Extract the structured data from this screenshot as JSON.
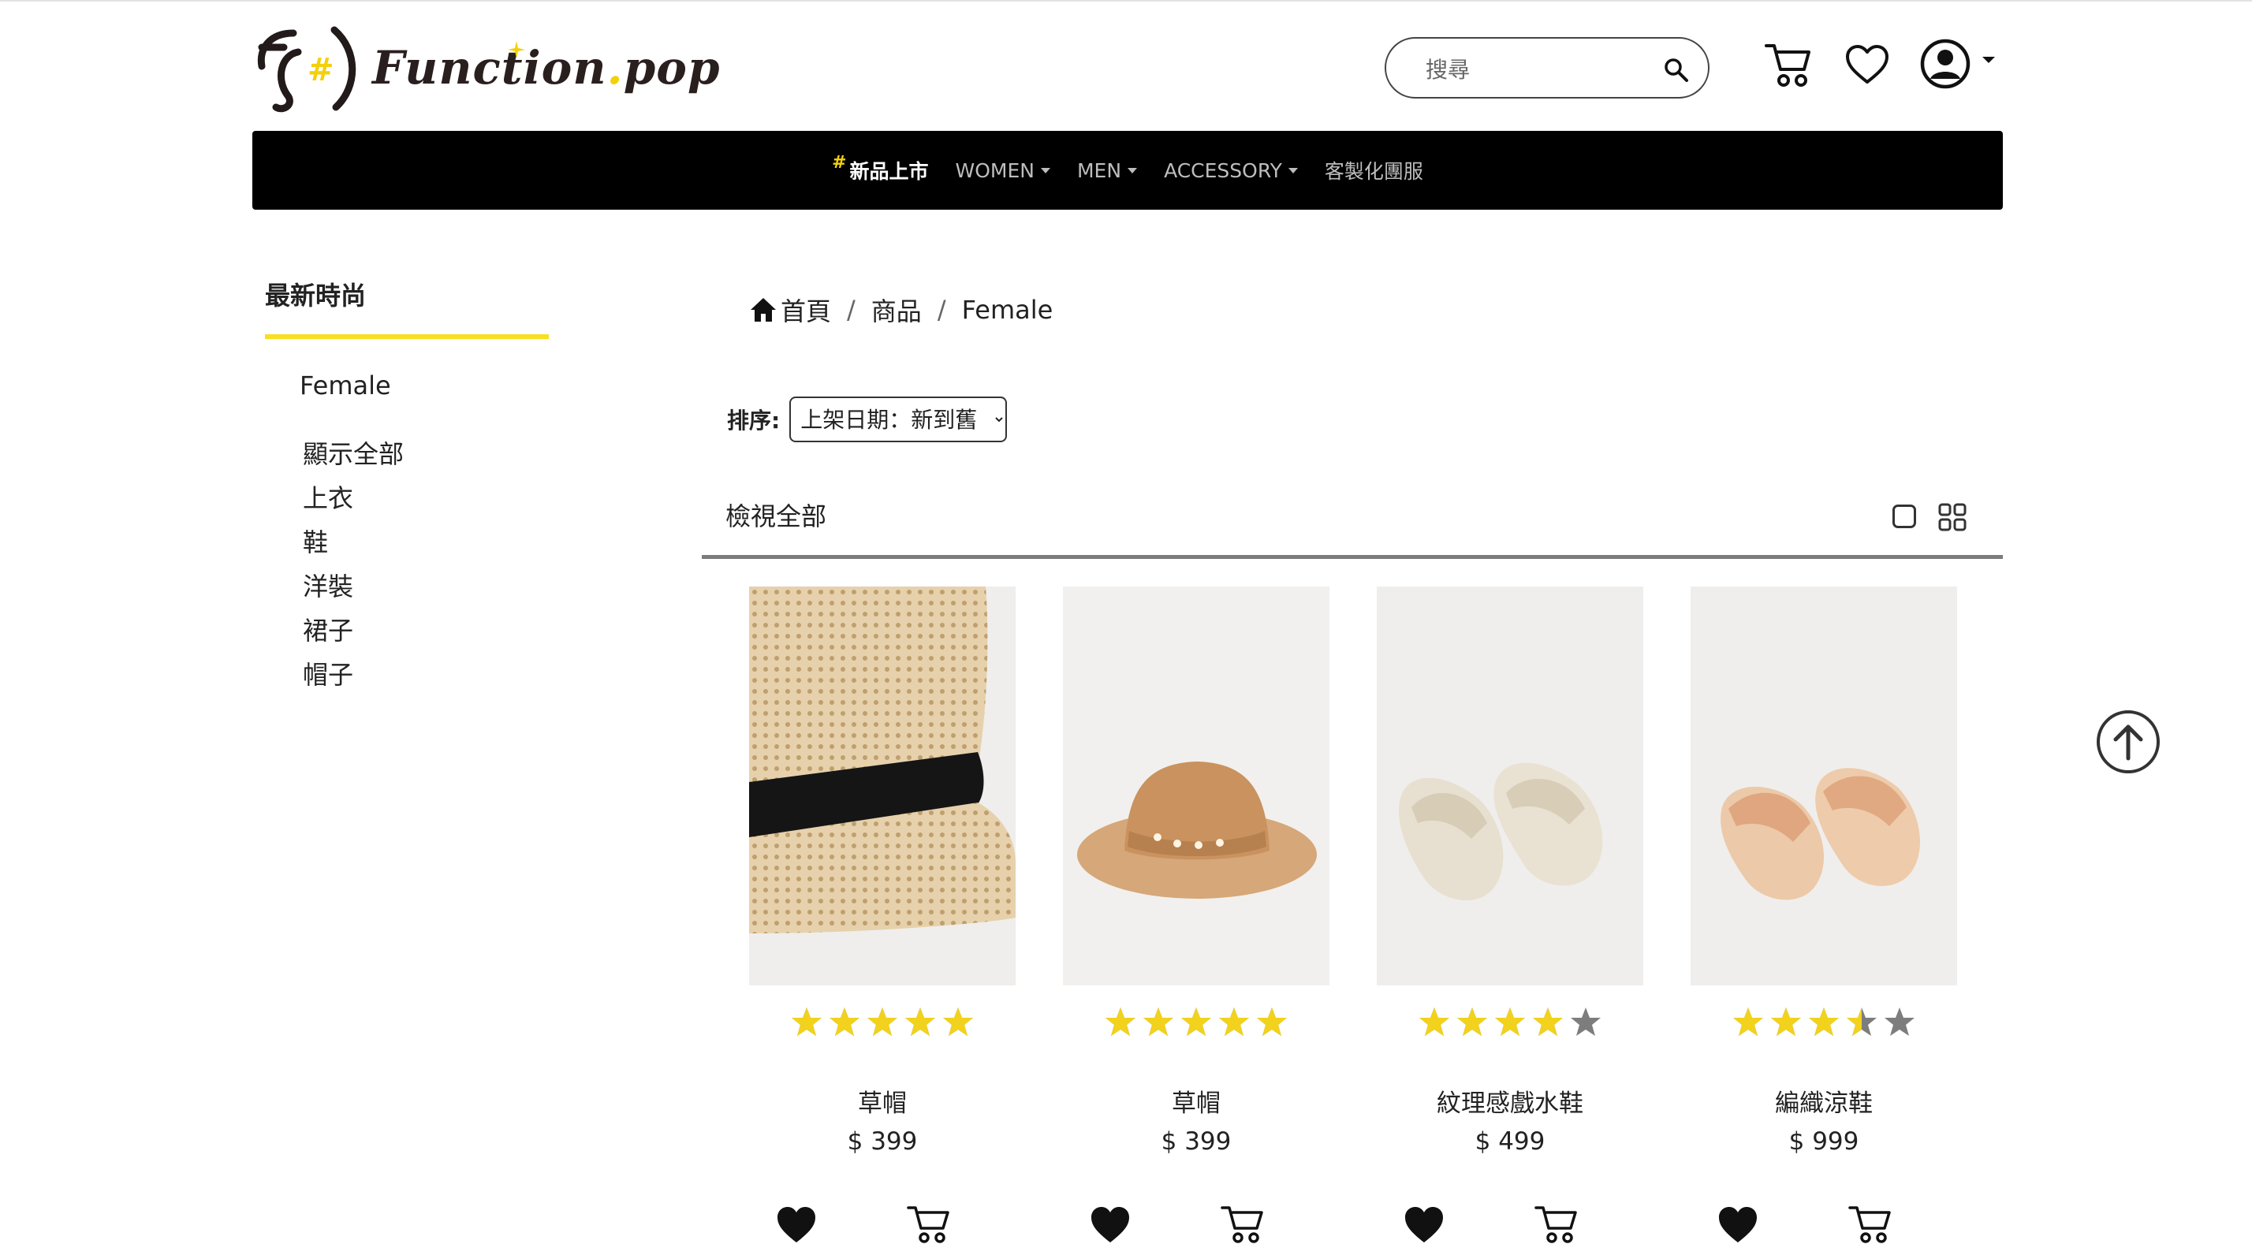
{
  "brand": {
    "name": "Function",
    "suffix": "pop",
    "dot": "."
  },
  "header": {
    "search": {
      "placeholder": "搜尋"
    }
  },
  "nav": {
    "items": [
      {
        "hash": "#",
        "label": "新品上市",
        "active": true,
        "dropdown": false
      },
      {
        "label": "WOMEN",
        "dropdown": true
      },
      {
        "label": "MEN",
        "dropdown": true
      },
      {
        "label": "ACCESSORY",
        "dropdown": true
      },
      {
        "label": "客製化團服",
        "dropdown": false
      }
    ]
  },
  "sidebar": {
    "title": "最新時尚",
    "category": "Female",
    "items": [
      "顯示全部",
      "上衣",
      "鞋",
      "洋裝",
      "裙子",
      "帽子"
    ]
  },
  "breadcrumb": {
    "home": "首頁",
    "level2": "商品",
    "level3": "Female",
    "separator": "/"
  },
  "sort": {
    "label": "排序:",
    "selected": "上架日期：新到舊"
  },
  "listing": {
    "heading": "檢視全部"
  },
  "products": [
    {
      "name": "草帽",
      "price": "$ 399",
      "rating": 5
    },
    {
      "name": "草帽",
      "price": "$ 399",
      "rating": 5
    },
    {
      "name": "紋理感戲水鞋",
      "price": "$ 499",
      "rating": 4
    },
    {
      "name": "編織涼鞋",
      "price": "$ 999",
      "rating": 3.5
    }
  ],
  "colors": {
    "accent": "#f3d00c",
    "star_on": "#f2d21c",
    "star_off": "#7d7d7d",
    "nav_bg": "#000000"
  }
}
